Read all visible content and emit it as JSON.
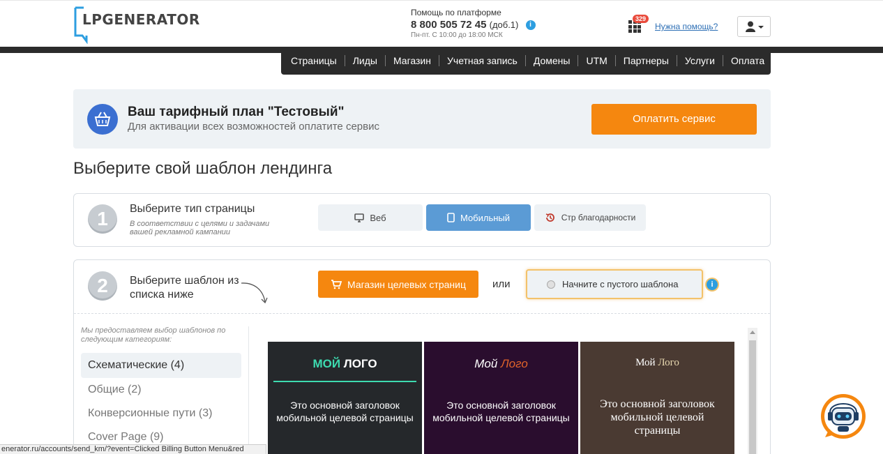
{
  "header": {
    "logo_text": "LPGENERATOR",
    "help_label": "Помощь по платформе",
    "phone": "8 800 505 72 45",
    "phone_ext": "(доб.1)",
    "hours": "Пн-пт. С 10:00 до 18:00 МСК",
    "notification_count": "329",
    "help_link": "Нужна помощь?"
  },
  "nav": {
    "items": [
      "Страницы",
      "Лиды",
      "Магазин",
      "Учетная запись",
      "Домены",
      "UTM",
      "Партнеры",
      "Услуги",
      "Оплата"
    ]
  },
  "tariff": {
    "title": "Ваш тарифный план \"Тестовый\"",
    "subtitle": "Для активации всех возможностей оплатите сервис",
    "pay_button": "Оплатить сервис"
  },
  "page_title": "Выберите свой шаблон лендинга",
  "step1": {
    "number": "1",
    "title": "Выберите тип страницы",
    "hint": "В соответствии с целями и задачами вашей рекламной кампании",
    "types": [
      "Веб",
      "Мобильный",
      "Стр благодарности"
    ],
    "selected": "Мобильный"
  },
  "step2": {
    "number": "2",
    "title": "Выберите шаблон из списка ниже",
    "shop_button": "Магазин целевых страниц",
    "or": "или",
    "empty_button": "Начните с пустого шаблона",
    "categories_hint": "Мы предоставляем выбор шаблонов по следующим категориям:",
    "categories": [
      "Схематические (4)",
      "Общие (2)",
      "Конверсионные пути (3)",
      "Cover Page (9)"
    ],
    "active_category": "Схематические (4)"
  },
  "templates": [
    {
      "logo_a": "МОЙ",
      "logo_b": " ЛОГО",
      "headline": "Это основной заголовок мобильной целевой страницы"
    },
    {
      "logo_a": "Мой",
      "logo_b": "Лого",
      "headline": "Это основной заголовок мобильной целевой страницы"
    },
    {
      "logo_a": "Мой",
      "logo_b": "Лого",
      "headline": "Это основной заголовок мобильной целевой страницы"
    }
  ],
  "status_url": "enerator.ru/accounts/send_km/?event=Clicked Billing Button Menu&red",
  "colors": {
    "accent_orange": "#f5870f",
    "selected_blue": "#5b9bd5",
    "nav_dark": "#2b2b2b",
    "info_blue": "#2d9ee0"
  }
}
